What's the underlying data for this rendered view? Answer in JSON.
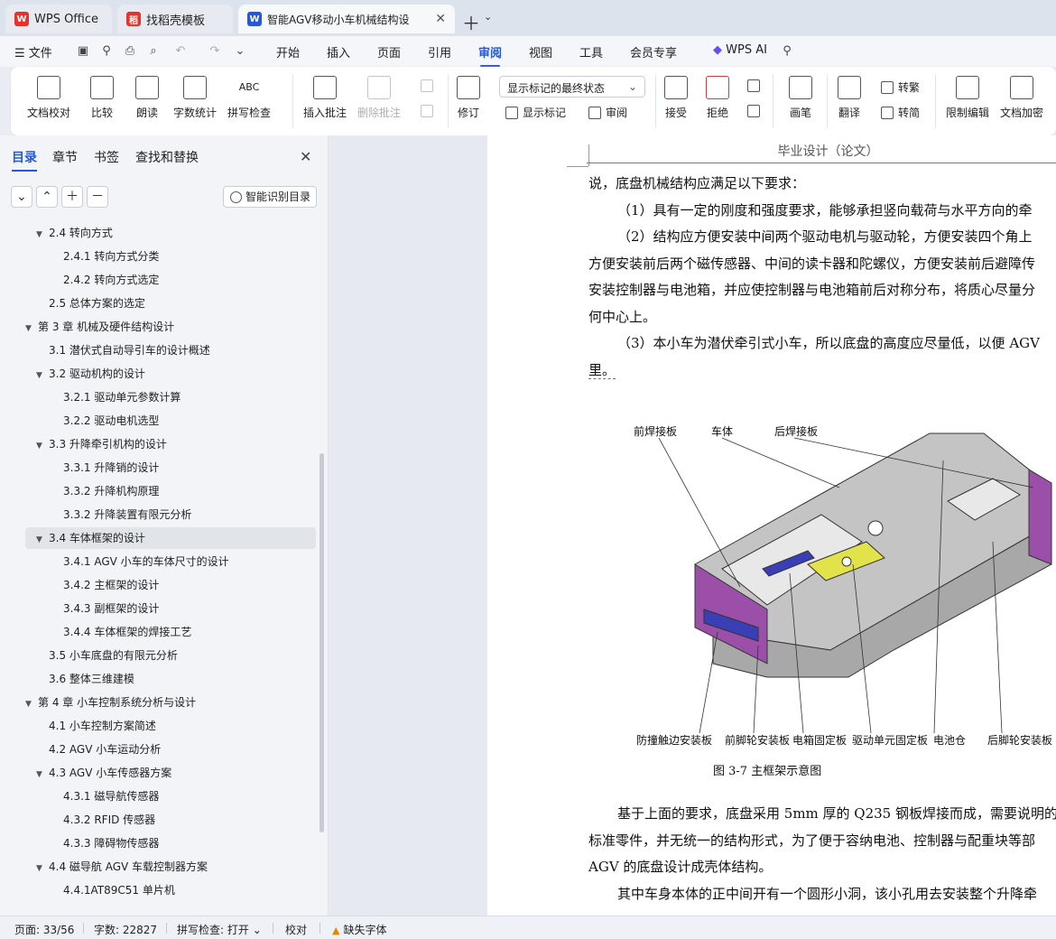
{
  "tabs": [
    {
      "label": "WPS Office",
      "icon": "wps-logo-icon",
      "color": "#e5322d"
    },
    {
      "label": "找稻壳模板",
      "icon": "docer-logo-icon",
      "color": "#e5322d"
    },
    {
      "label": "智能AGV移动小车机械结构设",
      "icon": "word-doc-icon",
      "color": "#2658d6"
    }
  ],
  "menu": {
    "file": "文件",
    "items": [
      "开始",
      "插入",
      "页面",
      "引用",
      "审阅",
      "视图",
      "工具",
      "会员专享"
    ],
    "active": "审阅",
    "wps_ai": "WPS AI"
  },
  "ribbon": {
    "doc_check": "文档校对",
    "compare": "比较",
    "read_aloud": "朗读",
    "word_count": "字数统计",
    "spell_check": "拼写检查",
    "insert_comment": "插入批注",
    "delete_comment": "删除批注",
    "track_changes": "修订",
    "markup_state": "显示标记的最终状态",
    "show_markup": "显示标记",
    "review_pane": "审阅",
    "accept": "接受",
    "reject": "拒绝",
    "pen": "画笔",
    "translate": "翻译",
    "to_traditional": "转繁",
    "to_simplified": "转简",
    "restrict_edit": "限制编辑",
    "doc_encrypt": "文档加密"
  },
  "nav": {
    "tabs": [
      "目录",
      "章节",
      "书签",
      "查找和替换"
    ],
    "active_tab": "目录",
    "smart_toc": "智能识别目录",
    "toc": [
      {
        "label": "2.4  转向方式",
        "level": 2,
        "expanded": true
      },
      {
        "label": "2.4.1  转向方式分类",
        "level": 3
      },
      {
        "label": "2.4.2  转向方式选定",
        "level": 3
      },
      {
        "label": "2.5  总体方案的选定",
        "level": 2
      },
      {
        "label": "第 3 章  机械及硬件结构设计",
        "level": 1,
        "expanded": true
      },
      {
        "label": "3.1  潜伏式自动导引车的设计概述",
        "level": 2
      },
      {
        "label": "3.2  驱动机构的设计",
        "level": 2,
        "expanded": true
      },
      {
        "label": "3.2.1  驱动单元参数计算",
        "level": 3
      },
      {
        "label": "3.2.2  驱动电机选型",
        "level": 3
      },
      {
        "label": "3.3  升降牵引机构的设计",
        "level": 2,
        "expanded": true
      },
      {
        "label": "3.3.1 升降销的设计",
        "level": 3
      },
      {
        "label": "3.3.2  升降机构原理",
        "level": 3
      },
      {
        "label": "3.3.2  升降装置有限元分析",
        "level": 3
      },
      {
        "label": "3.4  车体框架的设计",
        "level": 2,
        "expanded": true,
        "selected": true
      },
      {
        "label": "3.4.1 AGV 小车的车体尺寸的设计",
        "level": 3
      },
      {
        "label": "3.4.2  主框架的设计",
        "level": 3
      },
      {
        "label": "3.4.3  副框架的设计",
        "level": 3
      },
      {
        "label": "3.4.4  车体框架的焊接工艺",
        "level": 3
      },
      {
        "label": "3.5 小车底盘的有限元分析",
        "level": 2
      },
      {
        "label": "3.6  整体三维建模",
        "level": 2
      },
      {
        "label": "第 4 章  小车控制系统分析与设计",
        "level": 1,
        "expanded": true
      },
      {
        "label": "4.1  小车控制方案简述",
        "level": 2
      },
      {
        "label": "4.2 AGV 小车运动分析",
        "level": 2
      },
      {
        "label": "4.3 AGV 小车传感器方案",
        "level": 2,
        "expanded": true
      },
      {
        "label": "4.3.1 磁导航传感器",
        "level": 3
      },
      {
        "label": "4.3.2 RFID 传感器",
        "level": 3
      },
      {
        "label": "4.3.3  障碍物传感器",
        "level": 3
      },
      {
        "label": "4.4  磁导航 AGV 车载控制器方案",
        "level": 2,
        "expanded": true
      },
      {
        "label": "4.4.1AT89C51 单片机",
        "level": 3
      }
    ]
  },
  "document": {
    "header": "毕业设计（论文）",
    "paragraphs": [
      {
        "text": "说，底盘机械结构应满足以下要求：",
        "indent": false
      },
      {
        "text": "（1）具有一定的刚度和强度要求，能够承担竖向载荷与水平方向的牵",
        "indent": true
      },
      {
        "text": "（2）结构应方便安装中间两个驱动电机与驱动轮，方便安装四个角上",
        "indent": true
      },
      {
        "text": "方便安装前后两个磁传感器、中间的读卡器和陀螺仪，方便安装前后避障传",
        "indent": false
      },
      {
        "text": "安装控制器与电池箱，并应使控制器与电池箱前后对称分布，将质心尽量分",
        "indent": false
      },
      {
        "text": "何中心上。",
        "indent": false
      },
      {
        "text": "（3）本小车为潜伏牵引式小车，所以底盘的高度应尽量低，以便 AGV",
        "indent": true
      },
      {
        "text": "里。",
        "indent": false
      }
    ],
    "figure_labels_top": [
      "前焊接板",
      "车体",
      "后焊接板"
    ],
    "figure_labels_bottom": [
      "防撞触边安装板",
      "前脚轮安装板",
      "电箱固定板",
      "驱动单元固定板",
      "电池仓",
      "后脚轮安装板"
    ],
    "caption": "图 3-7  主框架示意图",
    "paragraphs_after": [
      {
        "text": "基于上面的要求，底盘采用 5mm 厚的 Q235 钢板焊接而成，需要说明的",
        "indent": true
      },
      {
        "text": "标准零件，并无统一的结构形式，为了便于容纳电池、控制器与配重块等部",
        "indent": false
      },
      {
        "text": "AGV 的底盘设计成壳体结构。",
        "indent": false
      },
      {
        "text": "其中车身本体的正中间开有一个圆形小洞，该小孔用去安装整个升降牵",
        "indent": true
      }
    ]
  },
  "status": {
    "page": "页面: 33/56",
    "words": "字数: 22827",
    "spell": "拼写检查: 打开",
    "proof": "校对",
    "missing_font": "缺失字体"
  },
  "colors": {
    "accent": "#2658d6",
    "frame_gray": "#bdbdbd",
    "frame_purple": "#9b4fa8",
    "frame_yellow": "#e2e34a",
    "frame_blue": "#3b3fb6"
  }
}
